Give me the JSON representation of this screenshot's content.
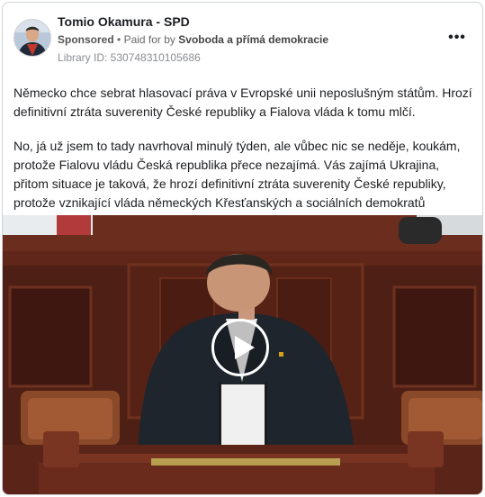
{
  "post": {
    "page_name": "Tomio Okamura - SPD",
    "sponsored_label": "Sponsored",
    "separator": "•",
    "paid_for_by_label": "Paid for by",
    "paid_for_by_name": "Svoboda a přímá demokracie",
    "library_id": "Library ID: 530748310105686",
    "more_icon": "more-options-icon",
    "more_label": "•••",
    "paragraphs": [
      "Německo chce sebrat hlasovací práva v Evropské unii neposlušným státům. Hrozí definitivní ztráta suverenity České republiky a Fialova vláda k tomu mlčí.",
      "No, já už jsem to tady navrhoval minulý týden, ale vůbec nic se neděje, koukám, protože Fialovu vládu Česká republika přece nezajímá. Vás zajímá Ukrajina, přitom situace je taková, že hrozí definitivní ztráta suverenity České republiky, protože vznikající vláda německých Křesťanských a sociálních demokratů navrhuje…"
    ]
  },
  "video": {
    "play_icon": "play-icon",
    "background_color": "#5a2418"
  }
}
